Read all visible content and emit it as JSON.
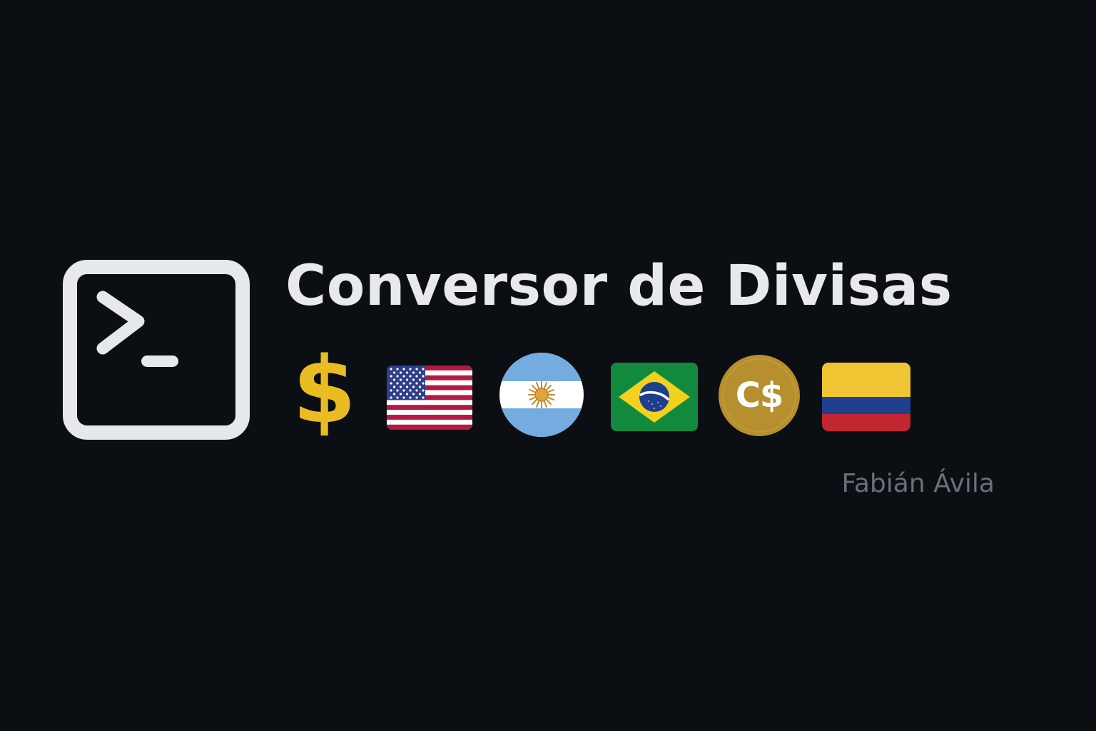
{
  "title": "Conversor de Divisas",
  "currency_symbol": "$",
  "cad_label": "C$",
  "author": "Fabián Ávila",
  "icons": {
    "terminal": "terminal-icon",
    "dollar": "dollar-icon",
    "usa": "usa-flag-icon",
    "argentina": "argentina-flag-icon",
    "brazil": "brazil-flag-icon",
    "canada": "canadian-dollar-coin-icon",
    "colombia": "colombia-flag-icon"
  },
  "colors": {
    "background": "#0b0e13",
    "title": "#e7e9ee",
    "terminal": "#e6e8ec",
    "dollar": "#e9bd22",
    "author": "#6b6f76",
    "usa_red": "#b31942",
    "usa_blue": "#2f3f8a",
    "argentina_blue": "#74acdf",
    "brazil_green": "#128a3d",
    "brazil_yellow": "#f2d21f",
    "brazil_blue": "#1d3f8d",
    "cad_gold": "#b68f2e",
    "colombia_yellow": "#f0c533",
    "colombia_blue": "#1f3f8f",
    "colombia_red": "#c2262e"
  }
}
